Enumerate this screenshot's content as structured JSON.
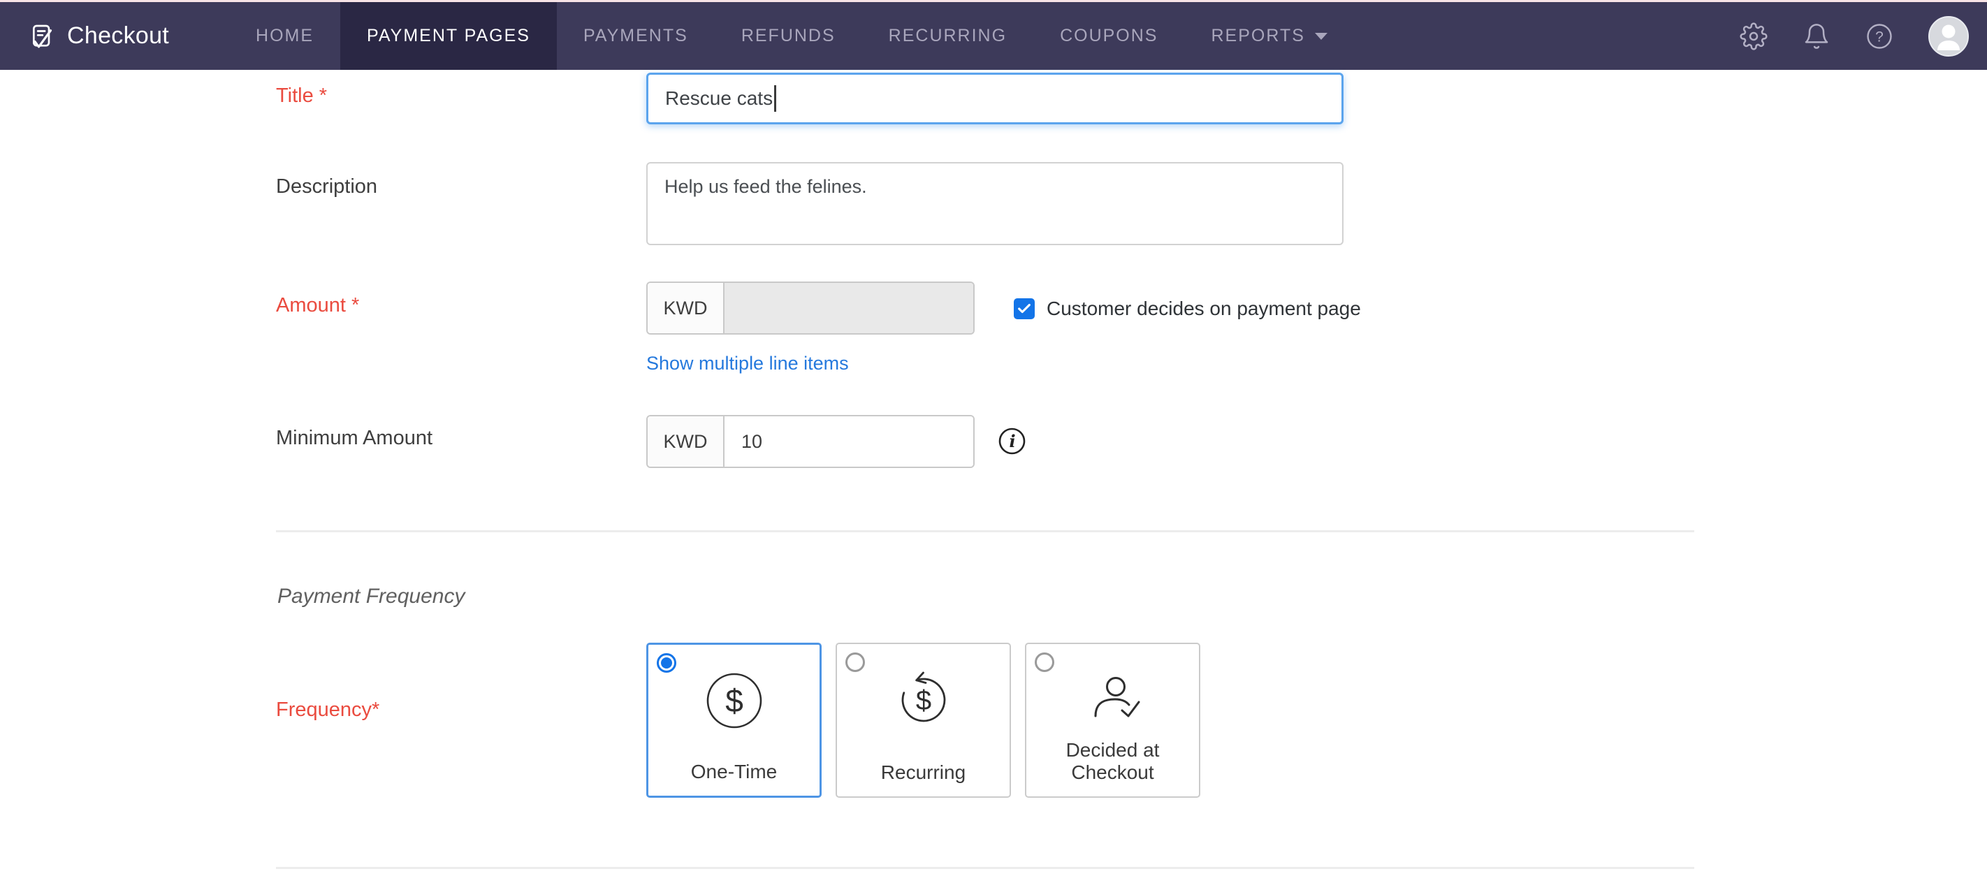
{
  "colors": {
    "navbar_bg": "#3d3a5a",
    "nav_active_bg": "#2a2744",
    "accent_blue": "#1374e8",
    "focus_border_blue": "#5ba4ed",
    "link_blue": "#2579dd",
    "required_red": "#ea4b3f"
  },
  "nav": {
    "brand": "Checkout",
    "brand_icon": "checkout-receipt-pen-icon",
    "items": [
      {
        "label": "HOME",
        "active": false,
        "dropdown": false
      },
      {
        "label": "PAYMENT PAGES",
        "active": true,
        "dropdown": false
      },
      {
        "label": "PAYMENTS",
        "active": false,
        "dropdown": false
      },
      {
        "label": "REFUNDS",
        "active": false,
        "dropdown": false
      },
      {
        "label": "RECURRING",
        "active": false,
        "dropdown": false
      },
      {
        "label": "COUPONS",
        "active": false,
        "dropdown": false
      },
      {
        "label": "REPORTS",
        "active": false,
        "dropdown": true
      }
    ],
    "right_icons": [
      {
        "name": "settings-icon"
      },
      {
        "name": "notifications-icon"
      },
      {
        "name": "help-icon"
      },
      {
        "name": "user-avatar"
      }
    ]
  },
  "form": {
    "title": {
      "label": "Title *",
      "value": "Rescue cats",
      "required": true,
      "focused": true
    },
    "description": {
      "label": "Description",
      "value": "Help us feed the felines."
    },
    "amount": {
      "label": "Amount *",
      "required": true,
      "currency": "KWD",
      "value": "",
      "disabled": true,
      "customer_decides": {
        "label": "Customer decides on payment page",
        "checked": true
      }
    },
    "line_items_link": "Show multiple line items",
    "minimum_amount": {
      "label": "Minimum Amount",
      "currency": "KWD",
      "value": "10",
      "info_icon": "info-icon"
    },
    "payment_frequency_heading": "Payment Frequency",
    "frequency": {
      "label": "Frequency*",
      "required": true,
      "options": [
        {
          "label": "One-Time",
          "icon": "one-time-dollar-icon",
          "selected": true
        },
        {
          "label": "Recurring",
          "icon": "recurring-cycle-icon",
          "selected": false
        },
        {
          "label": "Decided at Checkout",
          "icon": "decided-at-checkout-person-icon",
          "selected": false
        }
      ]
    }
  }
}
